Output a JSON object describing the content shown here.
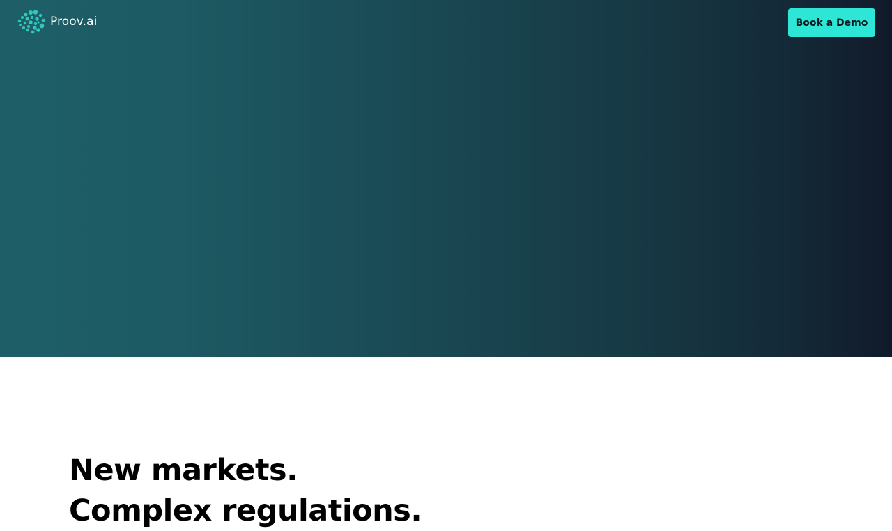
{
  "brand": {
    "name": "Proov.ai",
    "logo_icon": "dotted-circle-logo-icon",
    "accent_color": "#2ee6d6"
  },
  "nav": {
    "cta_label": "Book a Demo"
  },
  "hero": {
    "gradient_start": "#1e5f67",
    "gradient_end": "#111a2a"
  },
  "content": {
    "headline_line1": "New markets.",
    "headline_line2": "Complex regulations."
  }
}
